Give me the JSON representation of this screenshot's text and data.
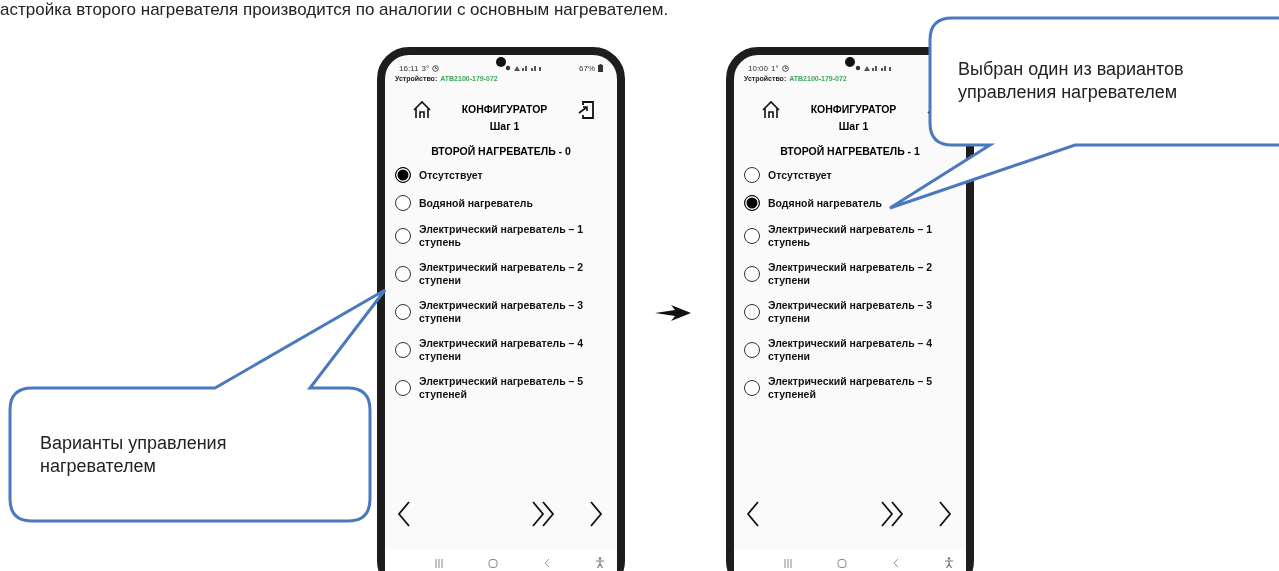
{
  "caption": "астройка второго нагревателя производится по аналогии с основным нагревателем.",
  "phones": [
    {
      "status": {
        "time": "16:11",
        "temp": "3°",
        "battery": "67%"
      },
      "device_label": "Устройство:",
      "device_id": "ATB2100-179-072",
      "title": "КОНФИГУРАТОР",
      "step": "Шаг 1",
      "heading": "ВТОРОЙ НАГРЕВАТЕЛЬ - 0",
      "options": [
        {
          "label": "Отсутствует",
          "selected": true
        },
        {
          "label": "Водяной нагреватель",
          "selected": false
        },
        {
          "label": "Электрический нагреватель – 1 ступень",
          "selected": false
        },
        {
          "label": "Электрический нагреватель – 2 ступени",
          "selected": false
        },
        {
          "label": "Электрический нагреватель – 3 ступени",
          "selected": false
        },
        {
          "label": "Электрический нагреватель – 4 ступени",
          "selected": false
        },
        {
          "label": "Электрический нагреватель – 5 ступеней",
          "selected": false
        }
      ]
    },
    {
      "status": {
        "time": "10:00",
        "temp": "1°"
      },
      "device_label": "Устройство:",
      "device_id": "ATB2100-179-072",
      "title": "КОНФИГУРАТОР",
      "step": "Шаг 1",
      "heading": "ВТОРОЙ НАГРЕВАТЕЛЬ - 1",
      "options": [
        {
          "label": "Отсутствует",
          "selected": false
        },
        {
          "label": "Водяной нагреватель",
          "selected": true
        },
        {
          "label": "Электрический нагреватель – 1 ступень",
          "selected": false
        },
        {
          "label": "Электрический нагреватель – 2 ступени",
          "selected": false
        },
        {
          "label": "Электрический нагреватель – 3 ступени",
          "selected": false
        },
        {
          "label": "Электрический нагреватель – 4 ступени",
          "selected": false
        },
        {
          "label": "Электрический нагреватель – 5 ступеней",
          "selected": false
        }
      ]
    }
  ],
  "callouts": [
    {
      "text": "Варианты управления нагревателем"
    },
    {
      "text": "Выбран один из вариантов управления нагревателем"
    }
  ]
}
